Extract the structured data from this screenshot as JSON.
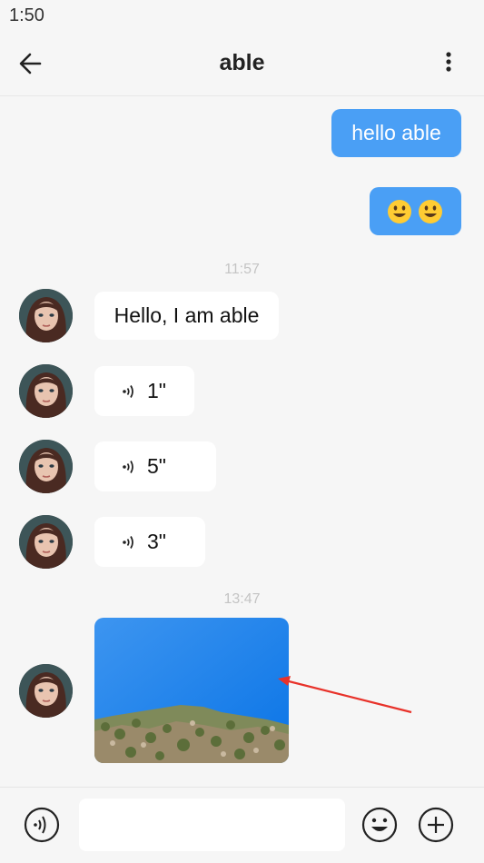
{
  "status_bar": {
    "time": "1:50"
  },
  "header": {
    "title": "able"
  },
  "messages": {
    "out_1": {
      "text": "hello able"
    },
    "out_2": {
      "emoji": "emoji-pair"
    },
    "time_1": "11:57",
    "in_1": {
      "text": "Hello, I am able"
    },
    "in_2": {
      "duration": "1\""
    },
    "in_3": {
      "duration": "5\""
    },
    "in_4": {
      "duration": "3\""
    },
    "time_2": "13:47"
  },
  "colors": {
    "outgoing_bubble": "#4a9ff5",
    "incoming_bubble": "#ffffff",
    "background": "#f6f6f6",
    "timestamp": "#c4c4c4",
    "annotation_arrow": "#e8322a"
  },
  "icons": {
    "back": "arrow-left-icon",
    "more": "more-vertical-icon",
    "voice": "voice-wave-icon",
    "emoji": "smiley-icon",
    "plus": "plus-circle-icon"
  },
  "input": {
    "placeholder": ""
  }
}
